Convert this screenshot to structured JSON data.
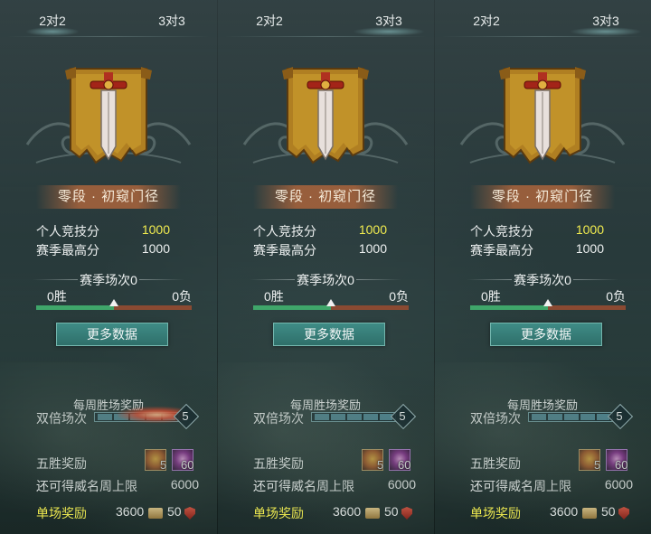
{
  "panels": [
    {
      "tabs": [
        {
          "label": "2对2"
        },
        {
          "label": "3对3"
        }
      ],
      "active_tab": 0,
      "rank_name": "零段 · 初窥门径",
      "personal_score_label": "个人竞技分",
      "personal_score": "1000",
      "season_best_label": "赛季最高分",
      "season_best": "1000",
      "season_matches": "赛季场次0",
      "wins": "0胜",
      "losses": "0负",
      "win_ratio": 0.5,
      "more_data_button": "更多数据",
      "weekly_reward_title": "每周胜场奖励",
      "double_label": "双倍场次",
      "double_count": "5",
      "double_filled": 0,
      "five_win_label": "五胜奖励",
      "five_win_items": [
        {
          "icon": "gold-chest-icon",
          "count": "5"
        },
        {
          "icon": "purple-gem-icon",
          "count": "60"
        }
      ],
      "fame_cap_label": "还可得威名周上限",
      "fame_cap_value": "6000",
      "single_reward_label": "单场奖励",
      "single_reward_coins": "3600",
      "single_reward_shields": "50"
    },
    {
      "tabs": [
        {
          "label": "2对2"
        },
        {
          "label": "3对3"
        }
      ],
      "active_tab": 1,
      "rank_name": "零段 · 初窥门径",
      "personal_score_label": "个人竞技分",
      "personal_score": "1000",
      "season_best_label": "赛季最高分",
      "season_best": "1000",
      "season_matches": "赛季场次0",
      "wins": "0胜",
      "losses": "0负",
      "win_ratio": 0.5,
      "more_data_button": "更多数据",
      "weekly_reward_title": "每周胜场奖励",
      "double_label": "双倍场次",
      "double_count": "5",
      "double_filled": 0,
      "five_win_label": "五胜奖励",
      "five_win_items": [
        {
          "icon": "gold-chest-icon",
          "count": "5"
        },
        {
          "icon": "purple-gem-icon",
          "count": "60"
        }
      ],
      "fame_cap_label": "还可得威名周上限",
      "fame_cap_value": "6000",
      "single_reward_label": "单场奖励",
      "single_reward_coins": "3600",
      "single_reward_shields": "50"
    },
    {
      "tabs": [
        {
          "label": "2对2"
        },
        {
          "label": "3对3"
        }
      ],
      "active_tab": 1,
      "rank_name": "零段 · 初窥门径",
      "personal_score_label": "个人竞技分",
      "personal_score": "1000",
      "season_best_label": "赛季最高分",
      "season_best": "1000",
      "season_matches": "赛季场次0",
      "wins": "0胜",
      "losses": "0负",
      "win_ratio": 0.5,
      "more_data_button": "更多数据",
      "weekly_reward_title": "每周胜场奖励",
      "double_label": "双倍场次",
      "double_count": "5",
      "double_filled": 0,
      "five_win_label": "五胜奖励",
      "five_win_items": [
        {
          "icon": "gold-chest-icon",
          "count": "5"
        },
        {
          "icon": "purple-gem-icon",
          "count": "60"
        }
      ],
      "fame_cap_label": "还可得威名周上限",
      "fame_cap_value": "6000",
      "single_reward_label": "单场奖励",
      "single_reward_coins": "3600",
      "single_reward_shields": "50"
    }
  ],
  "colors": {
    "highlight_yellow": "#f1ec4f",
    "win_bar": "#3fa66a",
    "loss_bar": "#8a4a32",
    "button_teal": "#2f6f6a",
    "rank_plate": "#aa643c"
  }
}
